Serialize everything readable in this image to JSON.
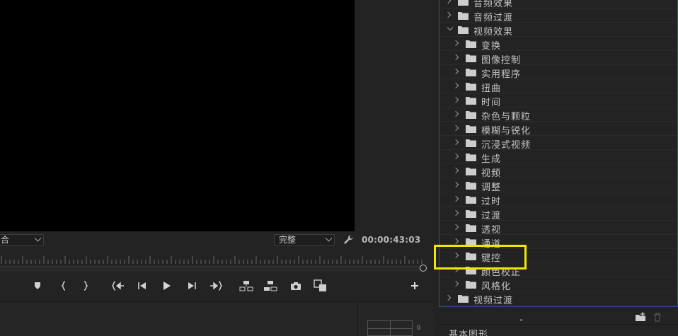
{
  "monitor": {
    "fit_value": "合",
    "quality_value": "完整",
    "timecode": "00:00:43:03"
  },
  "meter": {
    "zero_label": "0"
  },
  "effects_tree": [
    {
      "label": "音频效果",
      "level": 0,
      "expanded": false
    },
    {
      "label": "音频过渡",
      "level": 0,
      "expanded": false
    },
    {
      "label": "视频效果",
      "level": 0,
      "expanded": true
    },
    {
      "label": "变换",
      "level": 1,
      "expanded": false
    },
    {
      "label": "图像控制",
      "level": 1,
      "expanded": false
    },
    {
      "label": "实用程序",
      "level": 1,
      "expanded": false
    },
    {
      "label": "扭曲",
      "level": 1,
      "expanded": false
    },
    {
      "label": "时间",
      "level": 1,
      "expanded": false
    },
    {
      "label": "杂色与颗粒",
      "level": 1,
      "expanded": false
    },
    {
      "label": "模糊与锐化",
      "level": 1,
      "expanded": false
    },
    {
      "label": "沉浸式视频",
      "level": 1,
      "expanded": false
    },
    {
      "label": "生成",
      "level": 1,
      "expanded": false
    },
    {
      "label": "视频",
      "level": 1,
      "expanded": false
    },
    {
      "label": "调整",
      "level": 1,
      "expanded": false
    },
    {
      "label": "过时",
      "level": 1,
      "expanded": false
    },
    {
      "label": "过渡",
      "level": 1,
      "expanded": false
    },
    {
      "label": "透视",
      "level": 1,
      "expanded": false
    },
    {
      "label": "通道",
      "level": 1,
      "expanded": false
    },
    {
      "label": "键控",
      "level": 1,
      "expanded": false
    },
    {
      "label": "颜色校正",
      "level": 1,
      "expanded": false
    },
    {
      "label": "风格化",
      "level": 1,
      "expanded": false
    },
    {
      "label": "视频过渡",
      "level": 0,
      "expanded": false
    }
  ],
  "bottom_panel": {
    "label": "基本图形"
  },
  "colors": {
    "highlight": "#f2e600",
    "panel_focus_border": "#2f4f8f",
    "background": "#232323"
  },
  "icons": {
    "transport": [
      "add-marker-icon",
      "mark-in-icon",
      "mark-out-icon",
      "go-to-in-icon",
      "step-back-icon",
      "play-icon",
      "step-forward-icon",
      "go-to-out-icon",
      "lift-icon",
      "extract-icon",
      "export-frame-icon",
      "comparison-view-icon",
      "button-editor-plus-icon"
    ],
    "settings": "wrench-icon",
    "effects_footer": [
      "new-bin-icon",
      "trash-icon"
    ]
  }
}
